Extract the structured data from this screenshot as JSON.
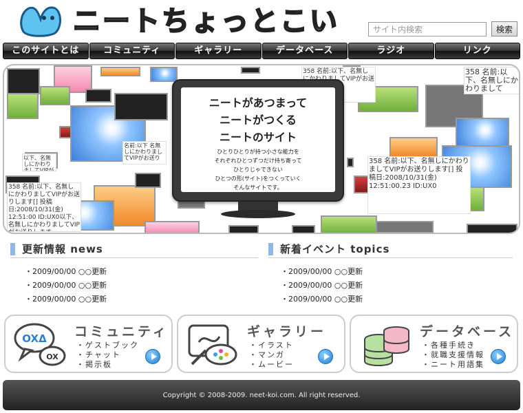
{
  "site": {
    "title": "ニートちょっとこい"
  },
  "search": {
    "placeholder": "サイト内検索",
    "button_label": "検索"
  },
  "nav": {
    "items": [
      {
        "label": "このサイトとは"
      },
      {
        "label": "コミュニティ"
      },
      {
        "label": "ギャラリー"
      },
      {
        "label": "データベース"
      },
      {
        "label": "ラジオ"
      },
      {
        "label": "リンク"
      }
    ]
  },
  "hero": {
    "headline": "ニートがあつまって\nニートがつくる\nニートのサイト",
    "body": "ひとりひとりが持つ小さな能力を\nそれぞれひとつずつだけ持ち寄って\nひとりじゃできない\nひとつの形(サイト)をつくっていく\nそんなサイトです。",
    "snippet_1": "358 名前:以下、名無しにかわりましてVIPがお送りします",
    "snippet_2": "358 名前:以下、名無しにかわりましてVIPがお送りします[] 投稿日:2008/10/31(金) 12:51:00.23 ID:UX0",
    "snippet_3": "358 名前:以下、名無しにかわりましてVIPがお送りします[] 投稿日:2008/10/31(金) 12:51:00 ID:UX0以下、名無しにかわりましてVIPがお送りします",
    "snippet_4": "358 名前:以下、名無しにかわりまして",
    "snippet_5": "名前:以下 名無しにかわりましてVIPがお送り",
    "snippet_6": "以下、名無しにかわりましてVIPがお送り"
  },
  "news": {
    "title": "更新情報 news",
    "items": [
      "・2009/00/00 ○○更新",
      "・2009/00/00 ○○更新",
      "・2009/00/00 ○○更新"
    ]
  },
  "topics": {
    "title": "新着イベント topics",
    "items": [
      "・2009/00/00 ○○更新",
      "・2009/00/00 ○○更新",
      "・2009/00/00 ○○更新"
    ]
  },
  "cards": {
    "community": {
      "title": "コミュニティ",
      "items": [
        "・ゲストブック",
        "・チャット",
        "・掲示板"
      ]
    },
    "gallery": {
      "title": "ギャラリー",
      "items": [
        "・イラスト",
        "・マンガ",
        "・ムービー"
      ]
    },
    "database": {
      "title": "データベース",
      "items": [
        "・各種手続き",
        "・就職支援情報",
        "・ニート用語集"
      ]
    }
  },
  "footer": {
    "copyright": "Copyright © 2008-2009. neet-koi.com. All right reserved."
  },
  "colors": {
    "accent_blue": "#8fb8e8",
    "nav_dark": "#222222",
    "footer_dark": "#333333"
  }
}
